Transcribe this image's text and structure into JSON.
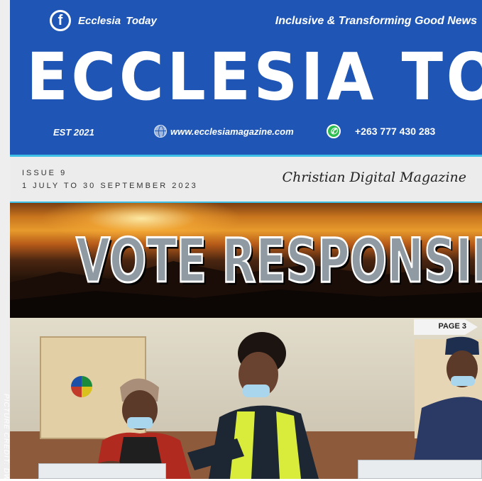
{
  "masthead": {
    "facebook_handle": "Ecclesia  Today",
    "tagline": "Inclusive & Transforming Good News",
    "title": "ECCLESIA TODAY",
    "established": "EST 2021",
    "website": "www.ecclesiamagazine.com",
    "phone": "+263 777 430 283",
    "colors": {
      "masthead_bg": "#1f56b5",
      "accent_line": "#3fc0e6"
    },
    "icons": [
      "facebook-icon",
      "globe-icon",
      "whatsapp-icon"
    ]
  },
  "issue_band": {
    "issue": "ISSUE 9",
    "dates": "1 JULY TO 30 SEPTEMBER 2023",
    "subtitle": "Christian Digital Magazine"
  },
  "headline": {
    "text": "VOTE RESPONSIBLY"
  },
  "photo": {
    "page_tag": "PAGE 3",
    "credit": "PICTURE CREDIT: DW"
  }
}
